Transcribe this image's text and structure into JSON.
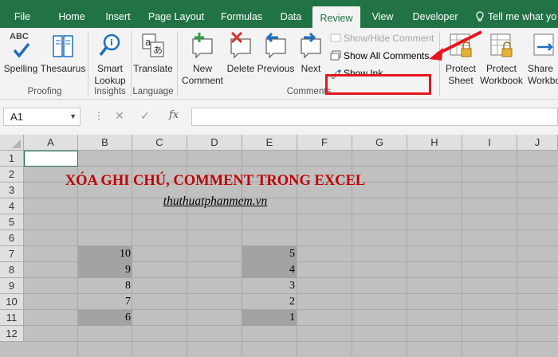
{
  "tabs": [
    {
      "label": "File"
    },
    {
      "label": "Home"
    },
    {
      "label": "Insert"
    },
    {
      "label": "Page Layout"
    },
    {
      "label": "Formulas"
    },
    {
      "label": "Data"
    },
    {
      "label": "Review"
    },
    {
      "label": "View"
    },
    {
      "label": "Developer"
    }
  ],
  "tell_me": "Tell me what yo",
  "ribbon": {
    "spelling": "Spelling",
    "thesaurus": "Thesaurus",
    "smart_lookup_1": "Smart",
    "smart_lookup_2": "Lookup",
    "translate": "Translate",
    "new_comment_1": "New",
    "new_comment_2": "Comment",
    "delete": "Delete",
    "previous": "Previous",
    "next": "Next",
    "show_hide_comment": "Show/Hide Comment",
    "show_all_comments": "Show All Comments",
    "show_ink": "Show Ink",
    "protect_sheet_1": "Protect",
    "protect_sheet_2": "Sheet",
    "protect_workbook_1": "Protect",
    "protect_workbook_2": "Workbook",
    "share_workbook_1": "Share",
    "share_workbook_2": "Workbo",
    "abc": "ABC",
    "groups": {
      "proofing": "Proofing",
      "insights": "Insights",
      "language": "Language",
      "comments": "Comments"
    }
  },
  "formula_bar": {
    "name_box": "A1",
    "fx": "fx"
  },
  "columns": [
    "A",
    "B",
    "C",
    "D",
    "E",
    "F",
    "G",
    "H",
    "I",
    "J"
  ],
  "rows": [
    "1",
    "2",
    "3",
    "4",
    "5",
    "6",
    "7",
    "8",
    "9",
    "10",
    "11",
    "12"
  ],
  "sheet": {
    "title": "XÓA GHI CHÚ, COMMENT TRONG EXCEL",
    "subtitle": "thuthuatphanmem.vn",
    "col_b": [
      "10",
      "9",
      "8",
      "7",
      "6"
    ],
    "col_e": [
      "5",
      "4",
      "3",
      "2",
      "1"
    ]
  },
  "colors": {
    "excel_green": "#217346",
    "title_red": "#c00000",
    "highlight_red": "#e8141c",
    "cell_gray": "#c0c0c0",
    "comment_cell_gray": "#a3a3a3"
  }
}
